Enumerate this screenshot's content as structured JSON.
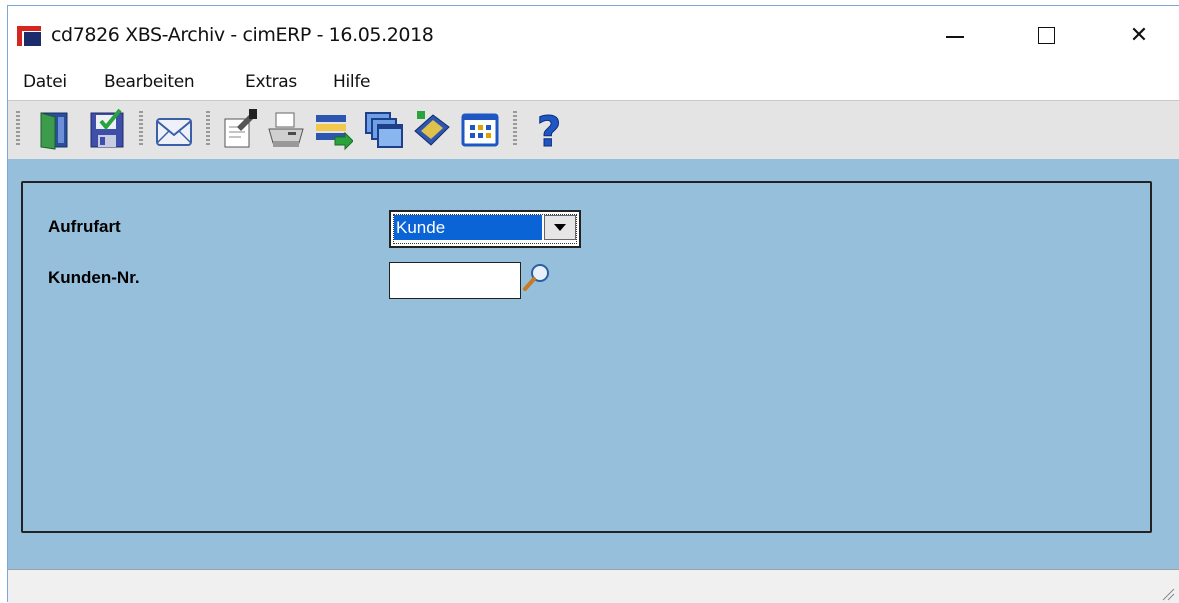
{
  "window": {
    "title": "cd7826 XBS-Archiv - cimERP - 16.05.2018",
    "controls": {
      "minimize": "minimize-icon",
      "maximize": "maximize-icon",
      "close": "close-icon",
      "close_glyph": "✕"
    }
  },
  "menu": {
    "items": [
      {
        "label": "Datei"
      },
      {
        "label": "Bearbeiten"
      },
      {
        "label": "Extras"
      },
      {
        "label": "Hilfe"
      }
    ]
  },
  "toolbar": {
    "buttons": [
      {
        "icon": "exit-door-icon"
      },
      {
        "icon": "save-icon"
      },
      {
        "icon": "mail-envelope-icon"
      },
      {
        "icon": "edit-document-icon"
      },
      {
        "icon": "printer-icon"
      },
      {
        "icon": "list-transfer-icon"
      },
      {
        "icon": "windows-cascade-icon"
      },
      {
        "icon": "book-icon"
      },
      {
        "icon": "table-grid-icon"
      },
      {
        "icon": "help-question-icon",
        "glyph": "?"
      }
    ]
  },
  "form": {
    "aufrufart": {
      "label": "Aufrufart",
      "value": "Kunde"
    },
    "kunden_nr": {
      "label": "Kunden-Nr.",
      "value": ""
    }
  },
  "colors": {
    "client_background": "#95bfdb",
    "selection": "#0a64d6",
    "toolbar": "#e4e4e4"
  }
}
